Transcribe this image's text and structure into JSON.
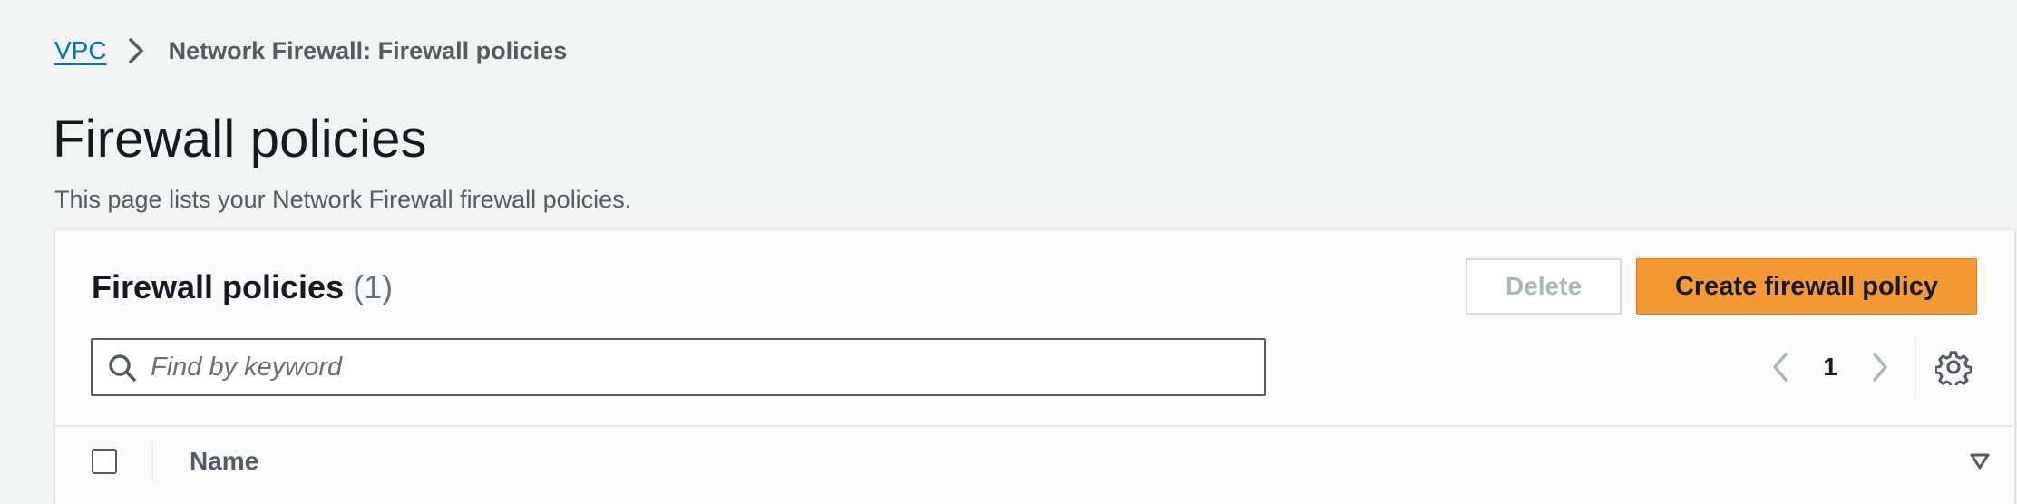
{
  "breadcrumb": {
    "root": "VPC",
    "current": "Network Firewall: Firewall policies"
  },
  "page": {
    "title": "Firewall policies",
    "description": "This page lists your Network Firewall firewall policies."
  },
  "panel": {
    "title": "Firewall policies",
    "count": "(1)",
    "delete_label": "Delete",
    "create_label": "Create firewall policy"
  },
  "search": {
    "placeholder": "Find by keyword",
    "value": ""
  },
  "pagination": {
    "current_page": "1"
  },
  "table": {
    "columns": [
      "Name"
    ]
  },
  "icons": {
    "breadcrumb_separator": "chevron-right-icon",
    "search": "search-icon",
    "prev": "chevron-left-icon",
    "next": "chevron-right-icon",
    "settings": "gear-icon",
    "sort": "sort-down-icon"
  },
  "colors": {
    "link": "#0073bb",
    "primary_button": "#f39a36",
    "background": "#f2f3f3",
    "panel": "#fafafa"
  }
}
